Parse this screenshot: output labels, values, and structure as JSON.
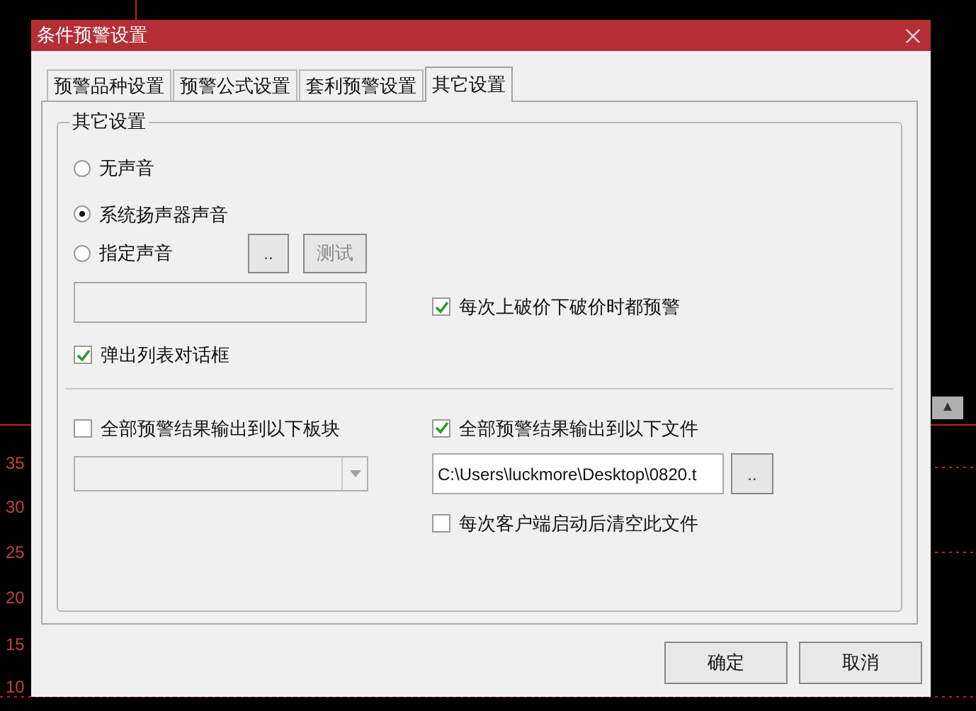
{
  "background_chart": {
    "axis_labels": [
      "35",
      "30",
      "25",
      "20",
      "15",
      "10"
    ],
    "scroll_button": "▲"
  },
  "dialog": {
    "title": "条件预警设置",
    "tabs": [
      {
        "label": "预警品种设置",
        "selected": false
      },
      {
        "label": "预警公式设置",
        "selected": false
      },
      {
        "label": "套利预警设置",
        "selected": false
      },
      {
        "label": "其它设置",
        "selected": true
      }
    ],
    "group_title": "其它设置",
    "sound_options": [
      {
        "label": "无声音",
        "selected": false
      },
      {
        "label": "系统扬声器声音",
        "selected": true
      },
      {
        "label": "指定声音",
        "selected": false
      }
    ],
    "browse_button": "..",
    "test_button": {
      "label": "测试",
      "disabled": true
    },
    "alert_each_break": {
      "label": "每次上破价下破价时都预警",
      "checked": true
    },
    "popup_list": {
      "label": "弹出列表对话框",
      "checked": true
    },
    "output_block": {
      "label": "全部预警结果输出到以下板块",
      "checked": false,
      "disabled": true
    },
    "output_file": {
      "label": "全部预警结果输出到以下文件",
      "checked": true,
      "path": "C:\\Users\\luckmore\\Desktop\\0820.t",
      "browse": ".."
    },
    "clear_file": {
      "label": "每次客户端启动后清空此文件",
      "checked": false
    },
    "buttons": [
      "确定",
      "取消"
    ]
  }
}
